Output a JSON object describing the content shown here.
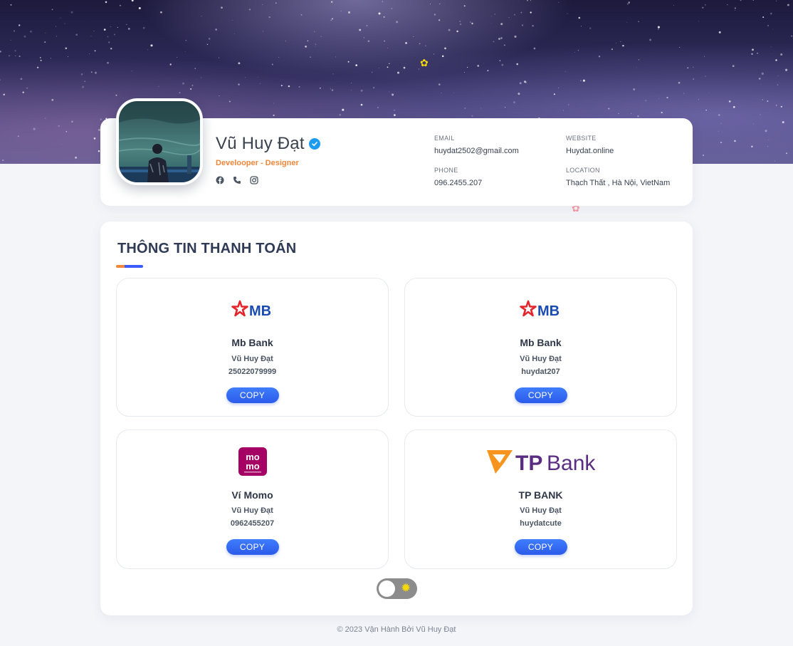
{
  "profile": {
    "name": "Vũ Huy Đạt",
    "role": "Develooper - Designer",
    "email_label": "EMAIL",
    "email": "huydat2502@gmail.com",
    "website_label": "WEBSITE",
    "website": "Huydat.online",
    "phone_label": "PHONE",
    "phone": "096.2455.207",
    "location_label": "LOCATION",
    "location": "Thạch Thất , Hà Nội, VietNam",
    "social_icons": [
      "facebook-icon",
      "phone-icon",
      "instagram-icon"
    ]
  },
  "payment": {
    "title": "THÔNG TIN THANH TOÁN",
    "banks": [
      {
        "logo_text": "MB",
        "name": "Mb Bank",
        "owner": "Vũ Huy Đạt",
        "account": "25022079999",
        "button": "COPY"
      },
      {
        "logo_text": "MB",
        "name": "Mb Bank",
        "owner": "Vũ Huy Đạt",
        "account": "huydat207",
        "button": "COPY"
      },
      {
        "logo_text": "mo mo",
        "name": "Ví Momo",
        "owner": "Vũ Huy Đạt",
        "account": "0962455207",
        "button": "COPY"
      },
      {
        "logo_text": "TPBank",
        "name": "TP BANK",
        "owner": "Vũ Huy Đạt",
        "account": "huydatcute",
        "button": "COPY"
      }
    ]
  },
  "footer": "© 2023 Vận Hành Bởi Vũ Huy Đạt",
  "colors": {
    "accent_orange": "#f0863a",
    "accent_blue": "#3b5bfd",
    "button_blue": "#2c5bea",
    "mb_red": "#e3262c",
    "mb_blue": "#1a4bb3",
    "momo": "#a50064",
    "tpbank_purple": "#5a2d82",
    "tpbank_orange": "#f7941d"
  }
}
